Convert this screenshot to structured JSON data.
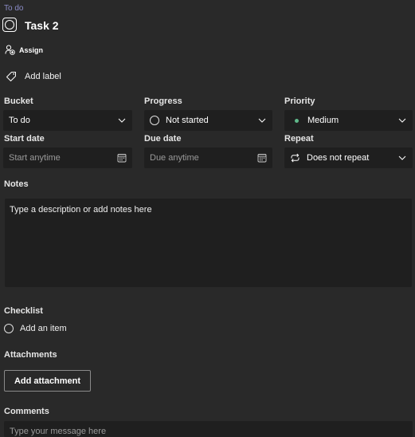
{
  "breadcrumb": "To do",
  "task": {
    "title": "Task 2"
  },
  "assign": {
    "label": "Assign",
    "icon": "person-add-icon"
  },
  "label": {
    "text": "Add label",
    "icon": "tag-icon"
  },
  "fields": {
    "bucket": {
      "label": "Bucket",
      "value": "To do"
    },
    "progress": {
      "label": "Progress",
      "value": "Not started"
    },
    "priority": {
      "label": "Priority",
      "value": "Medium",
      "dot_color": "#5fb88a"
    },
    "start_date": {
      "label": "Start date",
      "placeholder": "Start anytime"
    },
    "due_date": {
      "label": "Due date",
      "placeholder": "Due anytime"
    },
    "repeat": {
      "label": "Repeat",
      "value": "Does not repeat"
    }
  },
  "notes": {
    "label": "Notes",
    "placeholder": "Type a description or add notes here"
  },
  "checklist": {
    "label": "Checklist",
    "add_item": "Add an item"
  },
  "attachments": {
    "label": "Attachments",
    "button": "Add attachment"
  },
  "comments": {
    "label": "Comments",
    "placeholder": "Type your message here"
  },
  "colors": {
    "background": "#292929",
    "field_background": "#1f1f1f",
    "breadcrumb": "#8b8cc7",
    "priority_medium": "#5fb88a"
  }
}
